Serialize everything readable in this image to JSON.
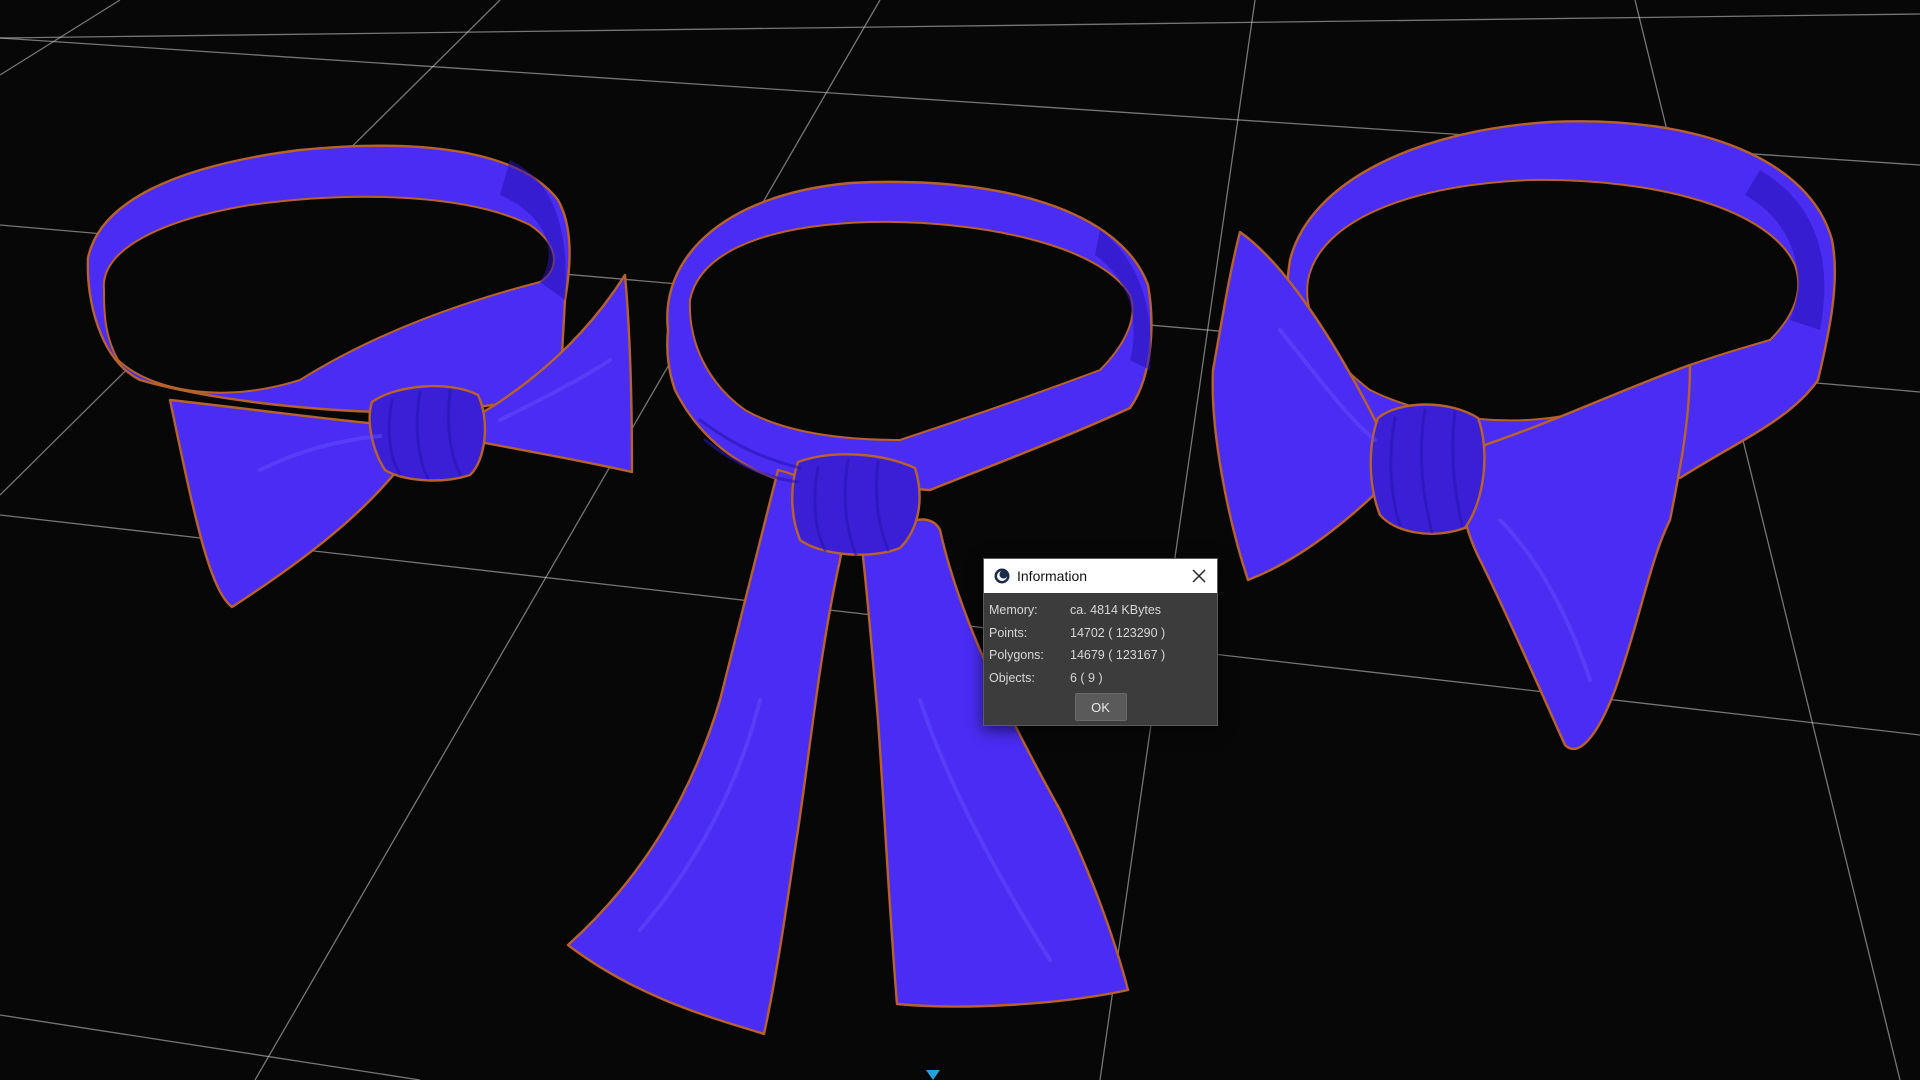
{
  "viewport": {
    "background": "#070707",
    "grid_color": "#cfcfcf",
    "object_color": "#4a2cf2",
    "outline_color": "#b8622a",
    "objects": [
      "bow-tie",
      "scarf-knot",
      "big-bow-tie"
    ]
  },
  "dialog": {
    "title": "Information",
    "icon": "cinema4d-icon",
    "close_icon": "close-icon",
    "rows": [
      {
        "label": "Memory:",
        "value": "ca. 4814 KBytes"
      },
      {
        "label": "Points:",
        "value": "14702 ( 123290 )"
      },
      {
        "label": "Polygons:",
        "value": "14679 ( 123167 )"
      },
      {
        "label": "Objects:",
        "value": "6 ( 9 )"
      }
    ],
    "ok_label": "OK"
  }
}
